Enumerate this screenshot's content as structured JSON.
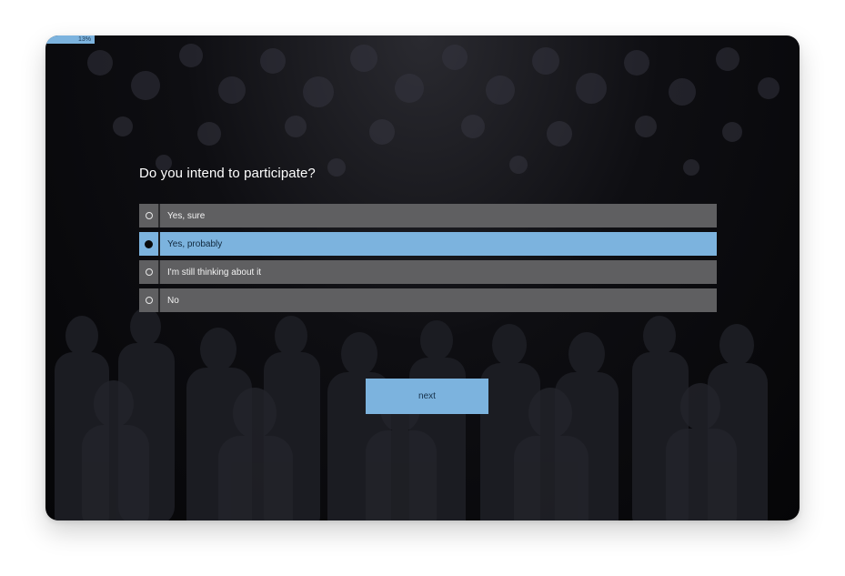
{
  "progress": {
    "label": "13%",
    "value": 0.13
  },
  "question": "Do you intend to participate?",
  "options": [
    {
      "label": "Yes, sure",
      "selected": false
    },
    {
      "label": "Yes, probably",
      "selected": true
    },
    {
      "label": "I'm still thinking about it",
      "selected": false
    },
    {
      "label": "No",
      "selected": false
    }
  ],
  "next_label": "next",
  "colors": {
    "accent": "#7cb3de",
    "option_bg": "#5f5f61",
    "background": "#0b0b0e"
  }
}
